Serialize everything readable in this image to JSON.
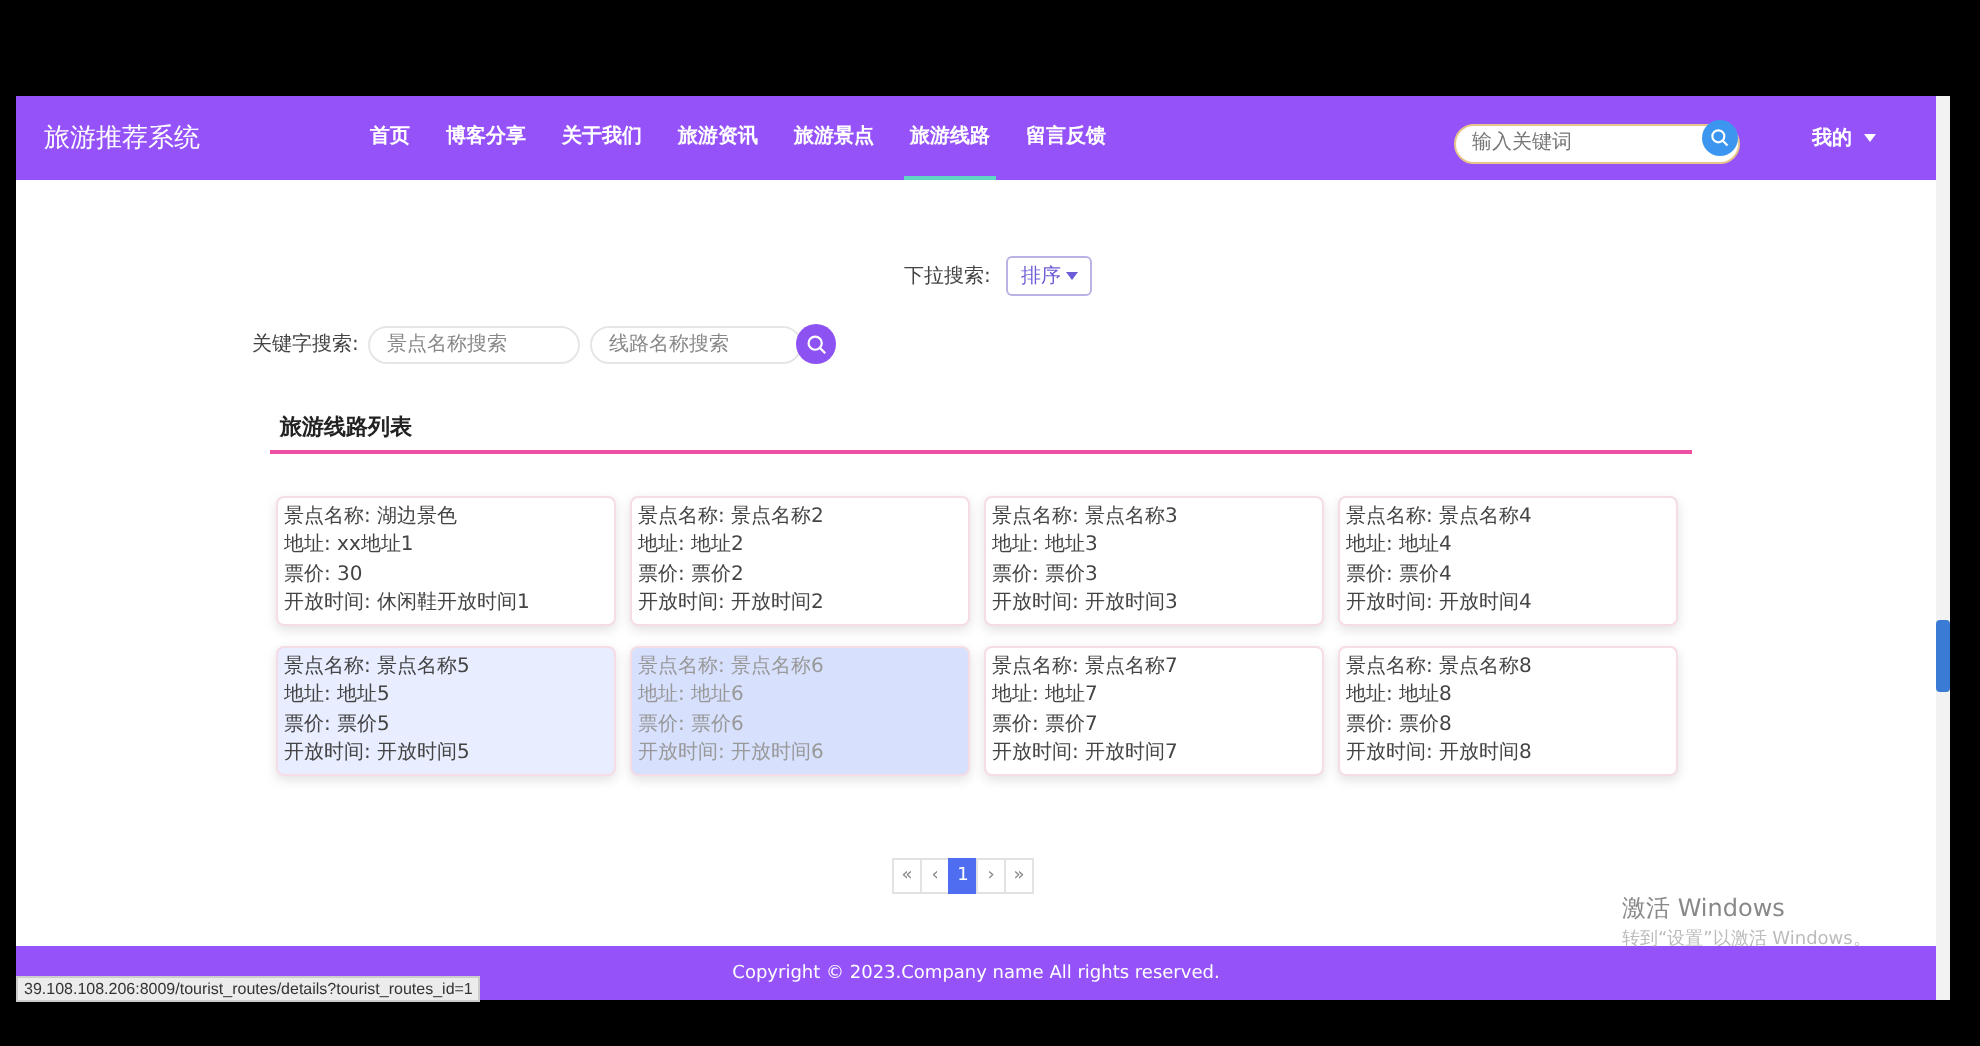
{
  "navbar": {
    "brand": "旅游推荐系统",
    "items": [
      {
        "label": "首页",
        "selected": false
      },
      {
        "label": "博客分享",
        "selected": false
      },
      {
        "label": "关于我们",
        "selected": false
      },
      {
        "label": "旅游资讯",
        "selected": false
      },
      {
        "label": "旅游景点",
        "selected": false
      },
      {
        "label": "旅游线路",
        "selected": true
      },
      {
        "label": "留言反馈",
        "selected": false
      }
    ],
    "search": {
      "placeholder": "输入关键词"
    },
    "user_menu": "我的"
  },
  "filters": {
    "dropdown_label": "下拉搜索:",
    "sort_button": "排序",
    "keyword_label": "关键字搜索:",
    "fields": [
      {
        "placeholder": "景点名称搜索"
      },
      {
        "placeholder": "线路名称搜索"
      }
    ]
  },
  "section_title": "旅游线路列表",
  "cards": [
    {
      "hovered": false,
      "selected": false,
      "lines": [
        "景点名称: 湖边景色",
        "地址: xx地址1",
        "票价: 30",
        "开放时间: 休闲鞋开放时间1"
      ]
    },
    {
      "hovered": false,
      "selected": false,
      "lines": [
        "景点名称: 景点名称2",
        "地址: 地址2",
        "票价: 票价2",
        "开放时间: 开放时间2"
      ]
    },
    {
      "hovered": false,
      "selected": false,
      "lines": [
        "景点名称: 景点名称3",
        "地址: 地址3",
        "票价: 票价3",
        "开放时间: 开放时间3"
      ]
    },
    {
      "hovered": false,
      "selected": false,
      "lines": [
        "景点名称: 景点名称4",
        "地址: 地址4",
        "票价: 票价4",
        "开放时间: 开放时间4"
      ]
    },
    {
      "hovered": true,
      "selected": false,
      "lines": [
        "景点名称: 景点名称5",
        "地址: 地址5",
        "票价: 票价5",
        "开放时间: 开放时间5"
      ]
    },
    {
      "hovered": false,
      "selected": true,
      "lines": [
        "景点名称: 景点名称6",
        "地址: 地址6",
        "票价: 票价6",
        "开放时间: 开放时间6"
      ]
    },
    {
      "hovered": false,
      "selected": false,
      "lines": [
        "景点名称: 景点名称7",
        "地址: 地址7",
        "票价: 票价7",
        "开放时间: 开放时间7"
      ]
    },
    {
      "hovered": false,
      "selected": false,
      "lines": [
        "景点名称: 景点名称8",
        "地址: 地址8",
        "票价: 票价8",
        "开放时间: 开放时间8"
      ]
    }
  ],
  "pagination": [
    {
      "label": "«",
      "selected": false
    },
    {
      "label": "‹",
      "selected": false
    },
    {
      "label": "1",
      "selected": true
    },
    {
      "label": "›",
      "selected": false
    },
    {
      "label": "»",
      "selected": false
    }
  ],
  "footer": "Copyright © 2023.Company name All rights reserved.",
  "status_url": "39.108.108.206:8009/tourist_routes/details?tourist_routes_id=1",
  "os_notice": [
    "激活 Windows",
    "转到“设置”以激活 Windows。"
  ]
}
